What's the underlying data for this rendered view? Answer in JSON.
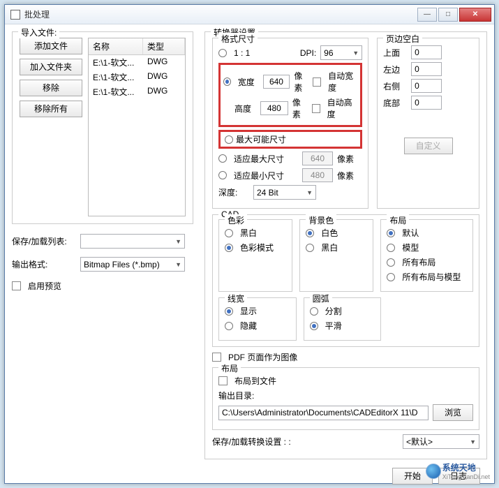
{
  "window": {
    "title": "批处理"
  },
  "import": {
    "legend": "导入文件:",
    "btn_add_file": "添加文件",
    "btn_add_folder": "加入文件夹",
    "btn_remove": "移除",
    "btn_remove_all": "移除所有",
    "col_name": "名称",
    "col_type": "类型",
    "rows": [
      {
        "name": "E:\\1-软文...",
        "type": "DWG"
      },
      {
        "name": "E:\\1-软文...",
        "type": "DWG"
      },
      {
        "name": "E:\\1-软文...",
        "type": "DWG"
      }
    ]
  },
  "left": {
    "save_list_label": "保存/加载列表:",
    "output_format_label": "输出格式:",
    "output_format_value": "Bitmap Files (*.bmp)",
    "enable_preview": "启用预览"
  },
  "converter": {
    "legend": "转换器设置",
    "fmt_legend": "格式尺寸",
    "ratio_11": "1 : 1",
    "dpi_label": "DPI:",
    "dpi_value": "96",
    "width_label": "宽度",
    "width_value": "640",
    "height_label": "高度",
    "height_value": "480",
    "px": "像素",
    "auto_w": "自动宽度",
    "auto_h": "自动高度",
    "max_possible": "最大可能尺寸",
    "fit_max": "适应最大尺寸",
    "fit_max_v": "640",
    "fit_min": "适应最小尺寸",
    "fit_min_v": "480",
    "depth_label": "深度:",
    "depth_value": "24 Bit",
    "margin": {
      "legend": "页边空白",
      "top": "上面",
      "top_v": "0",
      "left": "左边",
      "left_v": "0",
      "right": "右侧",
      "right_v": "0",
      "bottom": "底部",
      "bottom_v": "0",
      "custom": "自定义"
    },
    "cad": {
      "legend": "CAD",
      "color_legend": "色彩",
      "color_bw": "黑白",
      "color_mode": "色彩模式",
      "bg_legend": "背景色",
      "bg_white": "白色",
      "bg_black": "黑白",
      "layout_legend": "布局",
      "l_default": "默认",
      "l_model": "模型",
      "l_all": "所有布局",
      "l_all_model": "所有布局与模型",
      "lw_legend": "线宽",
      "lw_show": "显示",
      "lw_hide": "隐藏",
      "arc_legend": "圆弧",
      "arc_split": "分割",
      "arc_smooth": "平滑"
    },
    "pdf_as_image": "PDF 页面作为图像",
    "layout2_legend": "布局",
    "layout_to_file": "布局到文件",
    "outdir_label": "输出目录:",
    "outdir_value": "C:\\Users\\Administrator\\Documents\\CADEditorX 11\\D",
    "browse": "浏览",
    "save_load_settings": "保存/加载转换设置 : :",
    "save_load_value": "<默认>"
  },
  "footer": {
    "start": "开始",
    "log": "日志文件"
  },
  "watermark": {
    "line1": "系统天地",
    "line2": "XiTongTianDi.net"
  }
}
